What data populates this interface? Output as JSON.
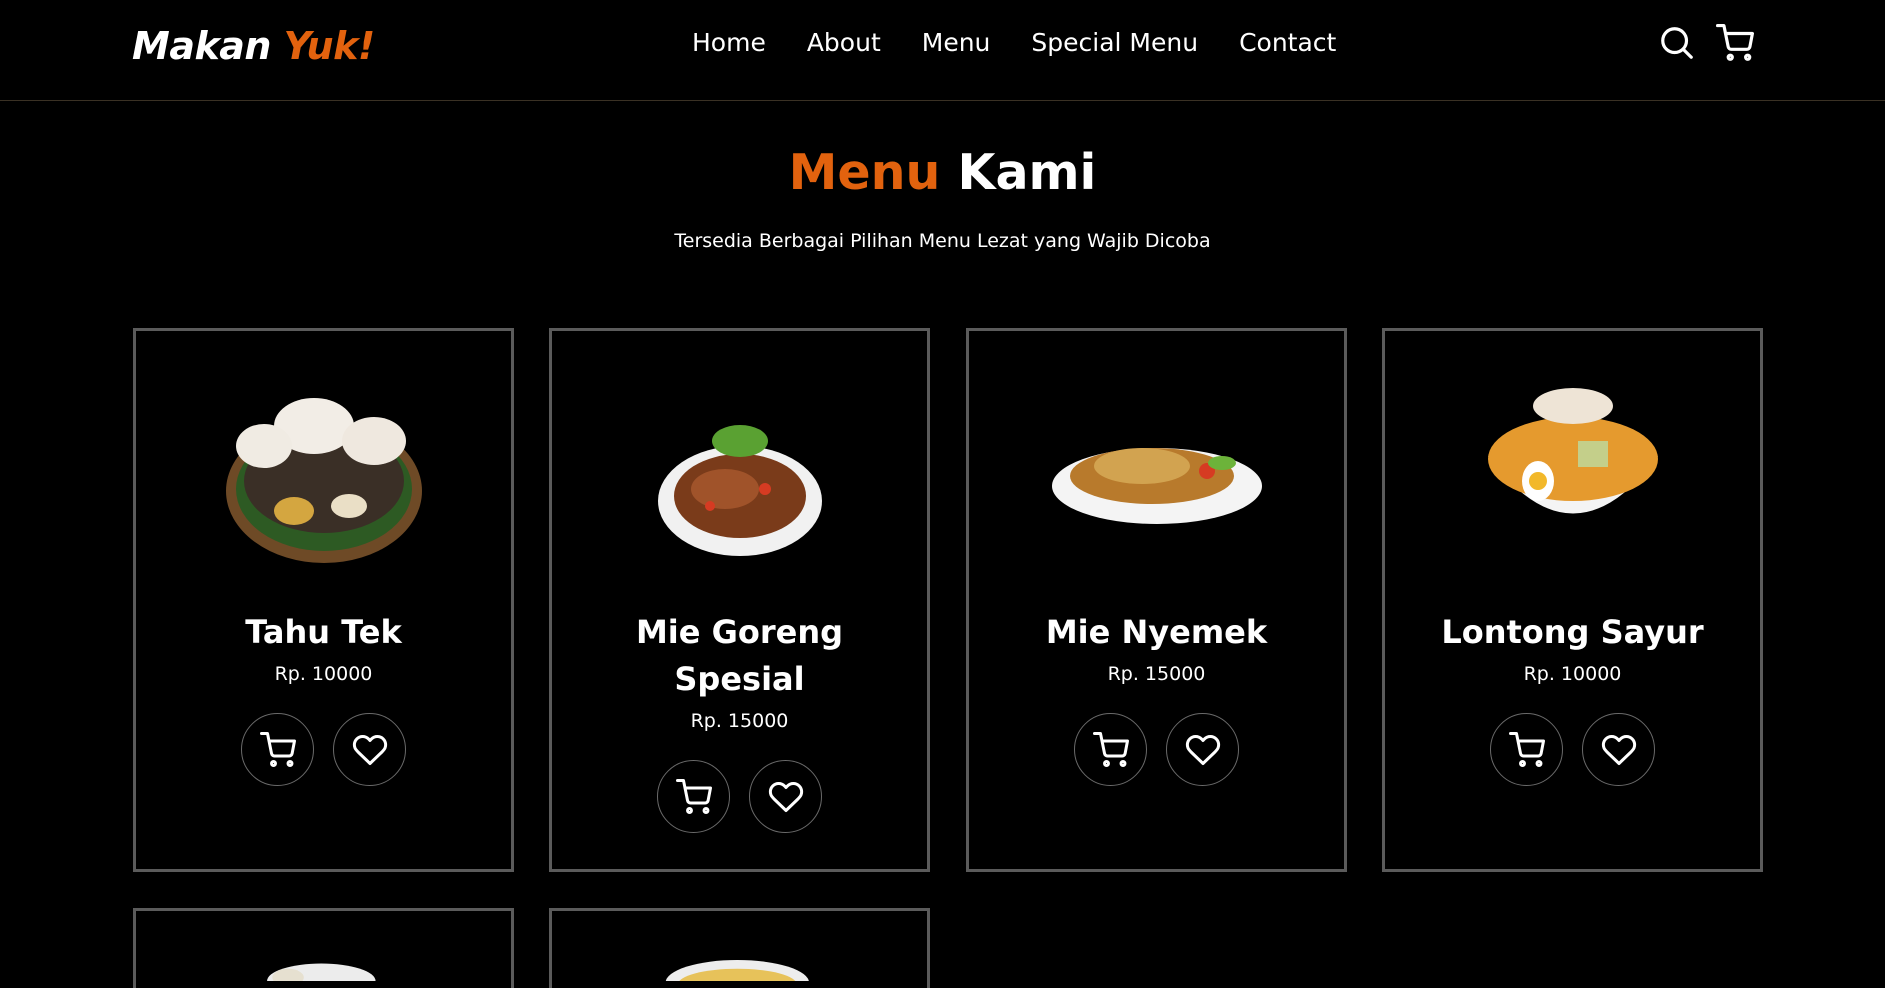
{
  "brand": {
    "name": "Makan",
    "accent": "Yuk!"
  },
  "nav": {
    "links": [
      "Home",
      "About",
      "Menu",
      "Special Menu",
      "Contact"
    ]
  },
  "section": {
    "title_accent": "Menu",
    "title_rest": "Kami",
    "subtitle": "Tersedia Berbagai Pilihan Menu Lezat yang Wajib Dicoba"
  },
  "menu": [
    {
      "name": "Tahu Tek",
      "price": "Rp. 10000"
    },
    {
      "name": "Mie Goreng Spesial",
      "price": "Rp. 15000"
    },
    {
      "name": "Mie Nyemek",
      "price": "Rp. 15000"
    },
    {
      "name": "Lontong Sayur",
      "price": "Rp. 10000"
    }
  ],
  "icons": [
    "search-icon",
    "cart-icon",
    "heart-icon"
  ],
  "colors": {
    "accent": "#e2620e",
    "background": "#000000",
    "card_border": "#5b5b5b"
  }
}
